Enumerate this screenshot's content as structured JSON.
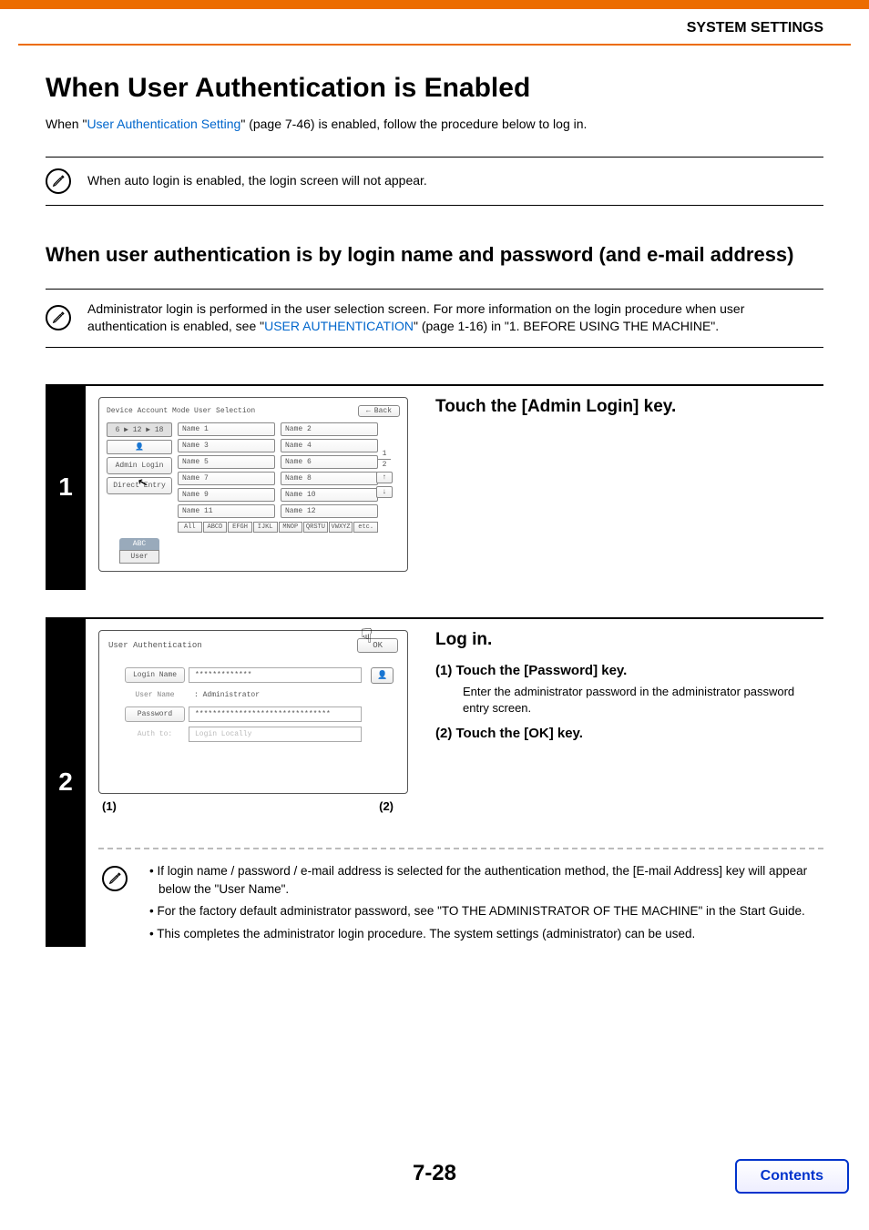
{
  "header": {
    "section_title": "SYSTEM SETTINGS"
  },
  "title": "When User Authentication is Enabled",
  "intro": {
    "prefix": "When \"",
    "link": "User Authentication Setting",
    "suffix": "\" (page 7-46) is enabled, follow the procedure below to log in."
  },
  "note1": "When auto login is enabled, the login screen will not appear.",
  "subtitle": "When user authentication is by login name and password (and e-mail address)",
  "note2": {
    "prefix": "Administrator login is performed in the user selection screen. For more information on the login procedure when user authentication is enabled, see \"",
    "link": "USER AUTHENTICATION",
    "suffix": "\" (page 1-16) in \"1. BEFORE USING THE MACHINE\"."
  },
  "step1": {
    "num": "1",
    "heading": "Touch the [Admin Login] key.",
    "panel": {
      "title": "Device Account Mode User Selection",
      "back": "Back",
      "paging": "6 ▶ 12 ▶ 18",
      "admin_login": "Admin Login",
      "direct_entry": "Direct Entry",
      "abc_tab": "ABC",
      "user_tab": "User",
      "page1": "1",
      "page2": "2",
      "up": "↑",
      "down": "↓",
      "names": [
        "Name 1",
        "Name 2",
        "Name 3",
        "Name 4",
        "Name 5",
        "Name 6",
        "Name 7",
        "Name 8",
        "Name 9",
        "Name 10",
        "Name 11",
        "Name 12"
      ],
      "filters": [
        "All",
        "ABCD",
        "EFGH",
        "IJKL",
        "MNOP",
        "QRSTU",
        "VWXYZ",
        "etc."
      ]
    }
  },
  "step2": {
    "num": "2",
    "heading": "Log in.",
    "sub1_label": "(1)  Touch the [Password] key.",
    "sub1_text": "Enter the administrator password in the administrator password entry screen.",
    "sub2_label": "(2)  Touch the [OK] key.",
    "callout1": "(1)",
    "callout2": "(2)",
    "panel": {
      "title": "User Authentication",
      "ok": "OK",
      "login_name_label": "Login Name",
      "login_name_value": "*************",
      "user_name_label": "User Name",
      "user_name_value": ": Administrator",
      "password_label": "Password",
      "password_value": "*******************************",
      "auth_to_label": "Auth to:",
      "auth_to_value": "Login Locally"
    },
    "bullets": [
      "If login name / password / e-mail address is selected for the authentication method, the [E-mail Address] key will appear below the \"User Name\".",
      "For the factory default administrator password, see \"TO THE ADMINISTRATOR OF THE MACHINE\" in the Start Guide.",
      "This completes the administrator login procedure. The system settings (administrator) can be used."
    ]
  },
  "footer": {
    "page": "7-28",
    "contents": "Contents"
  }
}
